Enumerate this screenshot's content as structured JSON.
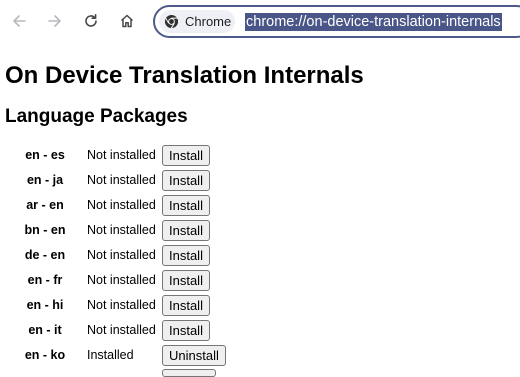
{
  "toolbar": {
    "back_icon": "arrow-left-icon",
    "forward_icon": "arrow-right-icon",
    "reload_icon": "reload-icon",
    "home_icon": "home-icon",
    "chip_label": "Chrome",
    "url": "chrome://on-device-translation-internals"
  },
  "page": {
    "title": "On Device Translation Internals",
    "section_heading": "Language Packages"
  },
  "packages": [
    {
      "pair": "en - es",
      "status": "Not installed",
      "action": "Install"
    },
    {
      "pair": "en - ja",
      "status": "Not installed",
      "action": "Install"
    },
    {
      "pair": "ar - en",
      "status": "Not installed",
      "action": "Install"
    },
    {
      "pair": "bn - en",
      "status": "Not installed",
      "action": "Install"
    },
    {
      "pair": "de - en",
      "status": "Not installed",
      "action": "Install"
    },
    {
      "pair": "en - fr",
      "status": "Not installed",
      "action": "Install"
    },
    {
      "pair": "en - hi",
      "status": "Not installed",
      "action": "Install"
    },
    {
      "pair": "en - it",
      "status": "Not installed",
      "action": "Install"
    },
    {
      "pair": "en - ko",
      "status": "Installed",
      "action": "Uninstall"
    }
  ],
  "colors": {
    "omnibox_border": "#4d5b8a",
    "url_selection": "#4a5688",
    "button_bg": "#efefef"
  }
}
